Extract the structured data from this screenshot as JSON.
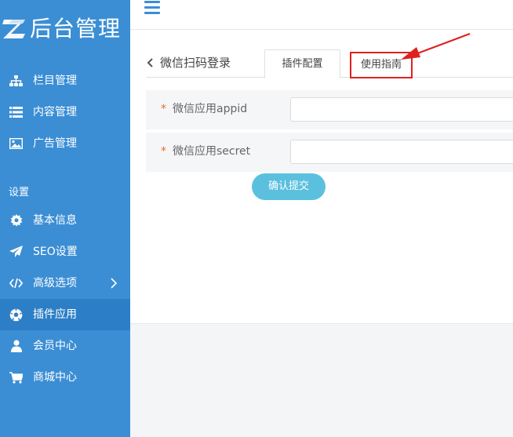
{
  "app": {
    "logo_mark": "Z",
    "logo_text": "后台管理"
  },
  "sidebar": {
    "items": [
      {
        "label": "栏目管理",
        "icon": "sitemap-icon"
      },
      {
        "label": "内容管理",
        "icon": "list-icon"
      },
      {
        "label": "广告管理",
        "icon": "image-icon"
      }
    ],
    "section_label": "设置",
    "settings_items": [
      {
        "label": "基本信息",
        "icon": "gear-icon"
      },
      {
        "label": "SEO设置",
        "icon": "paper-plane-icon"
      },
      {
        "label": "高级选项",
        "icon": "code-icon"
      },
      {
        "label": "插件应用",
        "icon": "soccer-ball-icon",
        "active": true
      },
      {
        "label": "会员中心",
        "icon": "user-icon"
      },
      {
        "label": "商城中心",
        "icon": "cart-icon"
      }
    ]
  },
  "topbar": {
    "menu_icon": "hamburger-icon"
  },
  "page": {
    "back_text": "微信扫码登录",
    "tabs": [
      {
        "label": "插件配置",
        "active": true
      },
      {
        "label": "使用指南",
        "highlighted": true
      }
    ],
    "fields": [
      {
        "required_mark": "*",
        "label": "微信应用appid",
        "value": "",
        "placeholder": ""
      },
      {
        "required_mark": "*",
        "label": "微信应用secret",
        "value": "",
        "placeholder": ""
      }
    ],
    "submit_label": "确认提交"
  },
  "colors": {
    "sidebar_bg": "#3b8ed4",
    "sidebar_active": "#2c7fc6",
    "button": "#5bc0de",
    "required": "#e86a2c",
    "annotation": "#e02020"
  }
}
